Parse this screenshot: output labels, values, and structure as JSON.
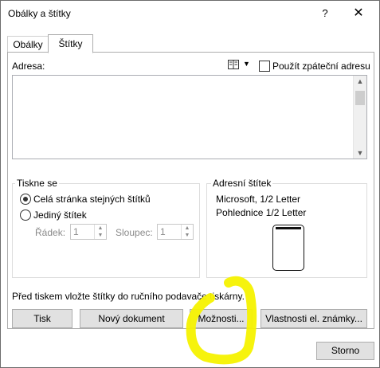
{
  "window": {
    "title": "Obálky a štítky",
    "help": "?",
    "close": "✕"
  },
  "tabs": [
    "Obálky",
    "Štítky"
  ],
  "address": {
    "label": "Adresa:",
    "use_return_label": "Použít zpáteční adresu",
    "value": ""
  },
  "print_group": {
    "title": "Tiskne se",
    "options": [
      "Celá stránka stejných štítků",
      "Jediný štítek"
    ],
    "selected": "Celá stránka stejných štítků",
    "row_label": "Řádek:",
    "row_value": "1",
    "col_label": "Sloupec:",
    "col_value": "1"
  },
  "label_group": {
    "title": "Adresní štítek",
    "line1": "Microsoft, 1/2 Letter",
    "line2": "Pohlednice 1/2 Letter"
  },
  "note": "Před tiskem vložte štítky do ručního podavače tiskárny.",
  "buttons": {
    "print": "Tisk",
    "new_document": "Nový dokument",
    "options": "Možnosti...",
    "stamp_properties": "Vlastnosti el. známky...",
    "cancel": "Storno"
  },
  "colors": {
    "highlight": "#f5f200"
  },
  "icons": [
    "address-book-icon",
    "dropdown-arrow-icon",
    "scroll-up-icon",
    "scroll-down-icon"
  ]
}
